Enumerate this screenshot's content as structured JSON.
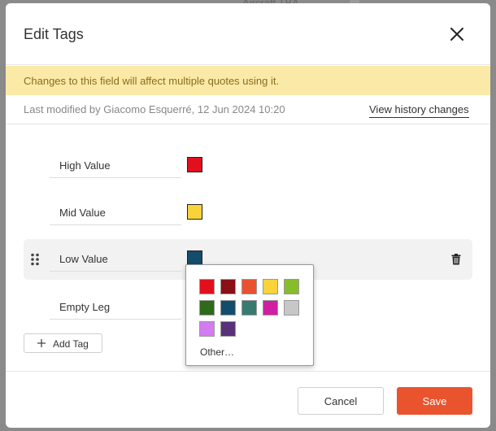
{
  "background": {
    "hint_text": "Aircraft TBA"
  },
  "dialog": {
    "title": "Edit Tags",
    "close_icon": "close-icon",
    "banner": "Changes to this field will affect multiple quotes using it.",
    "last_modified": "Last modified by Giacomo Esquerré, 12 Jun 2024 10:20",
    "history_link": "View history changes"
  },
  "tags": [
    {
      "label": "High Value",
      "color": "#e30f1d"
    },
    {
      "label": "Mid Value",
      "color": "#f8d33a"
    },
    {
      "label": "Low Value",
      "color": "#134d6b",
      "active": true
    },
    {
      "label": "Empty Leg",
      "color": ""
    }
  ],
  "palette": {
    "colors": [
      "#e30f1d",
      "#8b0f17",
      "#ea5130",
      "#f8d33a",
      "#87bd2b",
      "#2d6a1a",
      "#134d6b",
      "#367a70",
      "#d11fa1",
      "#c7c7c7",
      "#d37cf0",
      "#583178"
    ],
    "other_label": "Other…"
  },
  "actions": {
    "add_tag": "Add Tag",
    "cancel": "Cancel",
    "save": "Save"
  },
  "colors": {
    "accent": "#e9542f",
    "banner_bg": "#fbeaa7",
    "banner_text": "#8a6d1f"
  },
  "icons": {
    "drag": "drag-handle-icon",
    "trash": "trash-icon",
    "plus": "plus-icon"
  }
}
